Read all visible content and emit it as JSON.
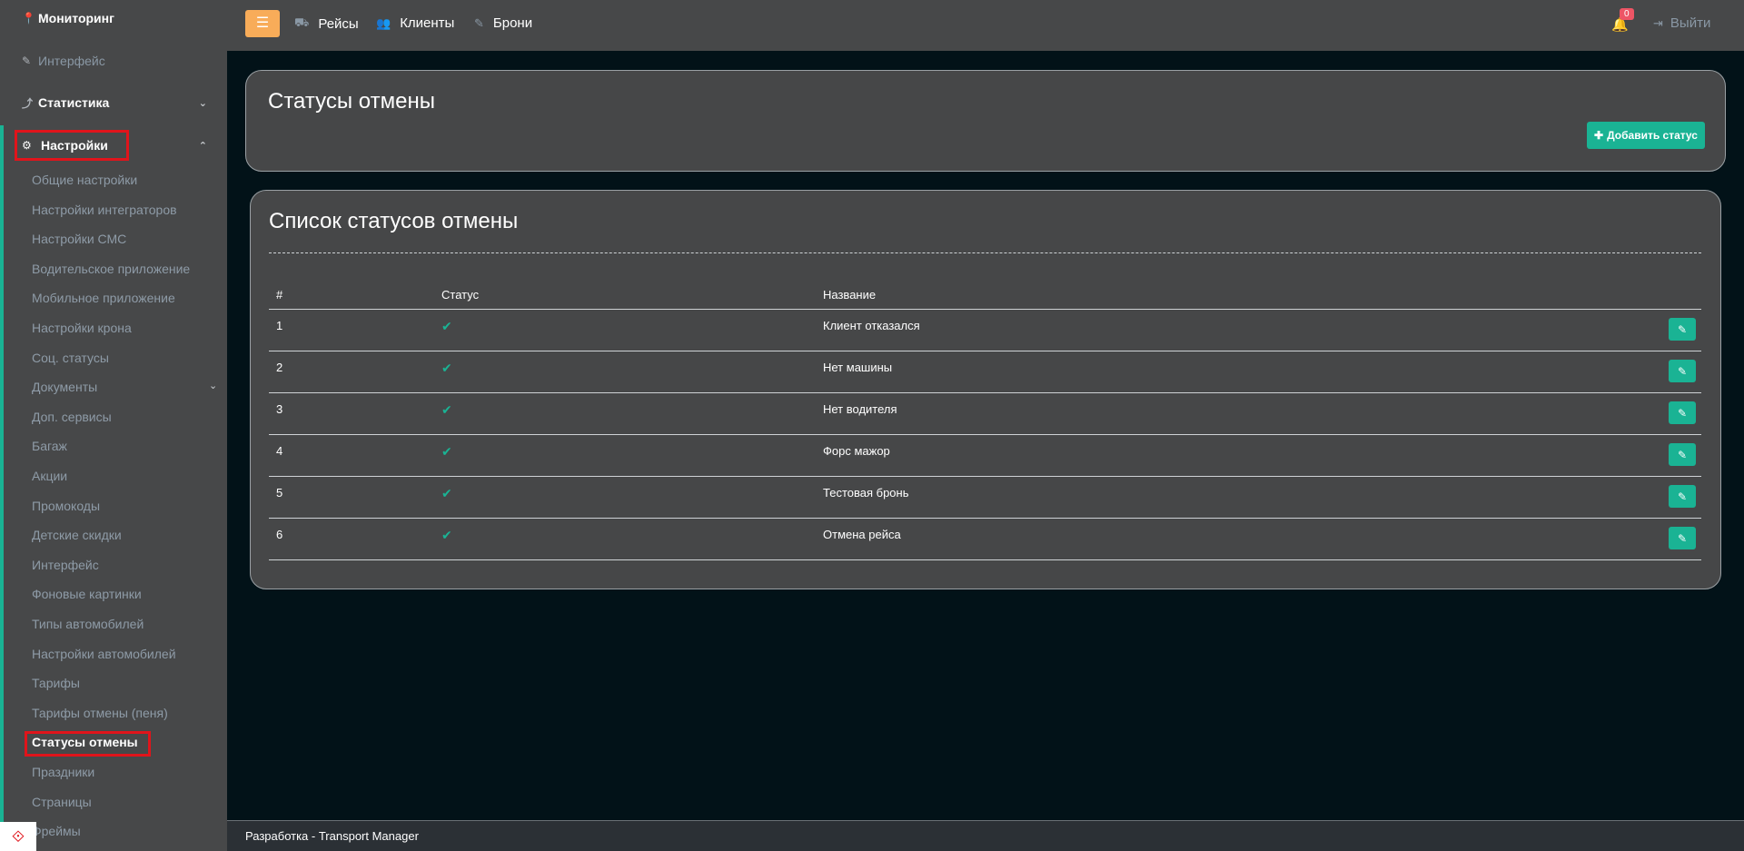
{
  "sidebar": {
    "monitoring": "Мониторинг",
    "interface": "Интерфейс",
    "statistics": "Статистика",
    "settings": "Настройки",
    "submenu": [
      "Общие настройки",
      "Настройки интеграторов",
      "Настройки СМС",
      "Водительское приложение",
      "Мобильное приложение",
      "Настройки крона",
      "Соц. статусы",
      "Документы",
      "Доп. сервисы",
      "Багаж",
      "Акции",
      "Промокоды",
      "Детские скидки",
      "Интерфейс",
      "Фоновые картинки",
      "Типы автомобилей",
      "Настройки автомобилей",
      "Тарифы",
      "Тарифы отмены (пеня)",
      "Статусы отмены",
      "Праздники",
      "Страницы",
      "Фреймы"
    ],
    "active_item": "Статусы отмены"
  },
  "topbar": {
    "menu_icon": "☰",
    "nav": [
      {
        "label": "Рейсы",
        "icon": "road-icon"
      },
      {
        "label": "Клиенты",
        "icon": "users-icon"
      },
      {
        "label": "Брони",
        "icon": "edit-icon"
      }
    ],
    "notifications_count": "0",
    "logout": "Выйти"
  },
  "header_panel": {
    "title": "Статусы отмены",
    "add_button": "Добавить статус"
  },
  "list_panel": {
    "title": "Список статусов отмены",
    "columns": [
      "#",
      "Статус",
      "Название"
    ],
    "rows": [
      {
        "num": "1",
        "status": "✔",
        "name": "Клиент отказался"
      },
      {
        "num": "2",
        "status": "✔",
        "name": "Нет машины"
      },
      {
        "num": "3",
        "status": "✔",
        "name": "Нет водителя"
      },
      {
        "num": "4",
        "status": "✔",
        "name": "Форс мажор"
      },
      {
        "num": "5",
        "status": "✔",
        "name": "Тестовая бронь"
      },
      {
        "num": "6",
        "status": "✔",
        "name": "Отмена рейса"
      }
    ]
  },
  "footer": {
    "text": "Разработка - Transport Manager"
  },
  "colors": {
    "accent": "#1ab394",
    "warning": "#f8ac59",
    "highlight": "#e0141b"
  }
}
